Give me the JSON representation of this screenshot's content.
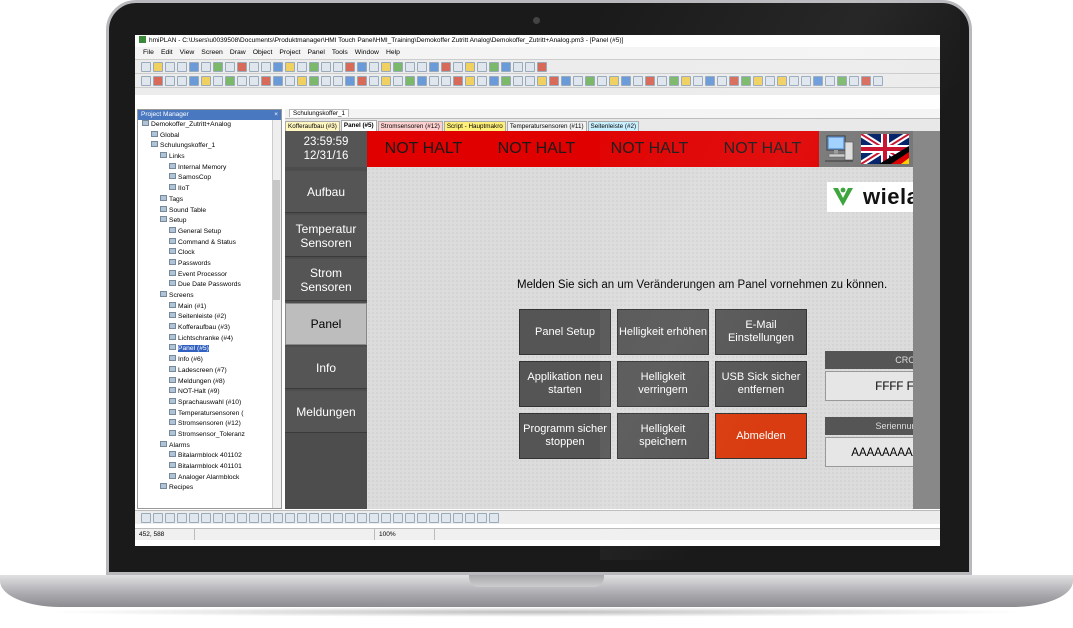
{
  "window": {
    "title": "hmiPLAN - C:\\Users\\u0039508\\Documents\\Produktmanager\\HMI Touch Panel\\HMI_Training\\Demokoffer Zutritt Analog\\Demokoffer_Zutritt+Analog.pm3 - [Panel (#5)]"
  },
  "menu": [
    "File",
    "Edit",
    "View",
    "Screen",
    "Draw",
    "Object",
    "Project",
    "Panel",
    "Tools",
    "Window",
    "Help"
  ],
  "project_manager": {
    "title": "Project Manager",
    "close": "×",
    "tree": [
      {
        "label": "Demokoffer_Zutritt+Analog",
        "indent": 0
      },
      {
        "label": "Global",
        "indent": 1
      },
      {
        "label": "Schulungskoffer_1",
        "indent": 1
      },
      {
        "label": "Links",
        "indent": 2
      },
      {
        "label": "Internal Memory",
        "indent": 3
      },
      {
        "label": "SamosCop",
        "indent": 3
      },
      {
        "label": "IIoT",
        "indent": 3
      },
      {
        "label": "Tags",
        "indent": 2
      },
      {
        "label": "Sound Table",
        "indent": 2
      },
      {
        "label": "Setup",
        "indent": 2
      },
      {
        "label": "General Setup",
        "indent": 3
      },
      {
        "label": "Command & Status",
        "indent": 3
      },
      {
        "label": "Clock",
        "indent": 3
      },
      {
        "label": "Passwords",
        "indent": 3
      },
      {
        "label": "Event Processor",
        "indent": 3
      },
      {
        "label": "Due Date Passwords",
        "indent": 3
      },
      {
        "label": "Screens",
        "indent": 2
      },
      {
        "label": "Main (#1)",
        "indent": 3
      },
      {
        "label": "Seitenleiste (#2)",
        "indent": 3
      },
      {
        "label": "Kofferaufbau (#3)",
        "indent": 3
      },
      {
        "label": "Lichtschranke (#4)",
        "indent": 3
      },
      {
        "label": "Panel (#5)",
        "indent": 3,
        "selected": true
      },
      {
        "label": "Info (#6)",
        "indent": 3
      },
      {
        "label": "Ladescreen (#7)",
        "indent": 3
      },
      {
        "label": "Meldungen (#8)",
        "indent": 3
      },
      {
        "label": "NOT-Halt (#9)",
        "indent": 3
      },
      {
        "label": "Sprachauswahl (#10)",
        "indent": 3
      },
      {
        "label": "Temperatursensoren (",
        "indent": 3
      },
      {
        "label": "Stromsensoren (#12)",
        "indent": 3
      },
      {
        "label": "Stromsensor_Toleranz",
        "indent": 3
      },
      {
        "label": "Alarms",
        "indent": 2
      },
      {
        "label": "Bitalarmblock 401102",
        "indent": 3
      },
      {
        "label": "Bitalarmblock 401101",
        "indent": 3
      },
      {
        "label": "Analoger Alarmblock",
        "indent": 3
      },
      {
        "label": "Recipes",
        "indent": 2
      }
    ]
  },
  "doc_tab": "Schulungskoffer_1",
  "screen_tabs": [
    {
      "label": "Kofferaufbau (#3)",
      "color": "#fff6c0"
    },
    {
      "label": "Panel (#5)",
      "color": "#ffffff",
      "active": true
    },
    {
      "label": "Stromsensoren (#12)",
      "color": "#ffd0d0"
    },
    {
      "label": "Script - Hauptmakro",
      "color": "#fff07a"
    },
    {
      "label": "Temperatursensoren (#11)",
      "color": "#f2f2f2"
    },
    {
      "label": "Seitenleiste (#2)",
      "color": "#c8f0ff"
    }
  ],
  "hmi": {
    "time": "23:59:59",
    "date": "12/31/16",
    "nav": [
      {
        "label": "Aufbau",
        "active": false
      },
      {
        "label": "Temperatur Sensoren",
        "active": false
      },
      {
        "label": "Strom Sensoren",
        "active": false
      },
      {
        "label": "Panel",
        "active": true
      },
      {
        "label": "Info",
        "active": false
      },
      {
        "label": "Meldungen",
        "active": false
      }
    ],
    "alarm_texts": [
      "NOT HALT",
      "NOT HALT",
      "NOT HALT",
      "NOT HALT"
    ],
    "logo_text": "wieland",
    "login_message": "Melden Sie sich an um Veränderungen am Panel vornehmen zu können.",
    "buttons": [
      {
        "label": "Panel Setup",
        "red": false
      },
      {
        "label": "Helligkeit erhöhen",
        "red": false
      },
      {
        "label": "E-Mail Einstellungen",
        "red": false
      },
      {
        "label": "Applikation neu starten",
        "red": false
      },
      {
        "label": "Helligkeit verringern",
        "red": false
      },
      {
        "label": "USB Sick sicher entfernen",
        "red": false
      },
      {
        "label": "Programm sicher stoppen",
        "red": false
      },
      {
        "label": "Helligkeit speichern",
        "red": false
      },
      {
        "label": "Abmelden",
        "red": true
      }
    ],
    "crc_label": "CRC",
    "crc_value": "FFFF FFFF",
    "serial_label": "Seriennummer",
    "serial_value": "AAAAAAAAAAAAAA"
  },
  "status": {
    "coords": "452, 588",
    "zoom": "100%"
  },
  "colors": {
    "alarm_bar": "#e00000",
    "logout_button": "#d93c10",
    "wieland_green": "#3aa33a"
  }
}
